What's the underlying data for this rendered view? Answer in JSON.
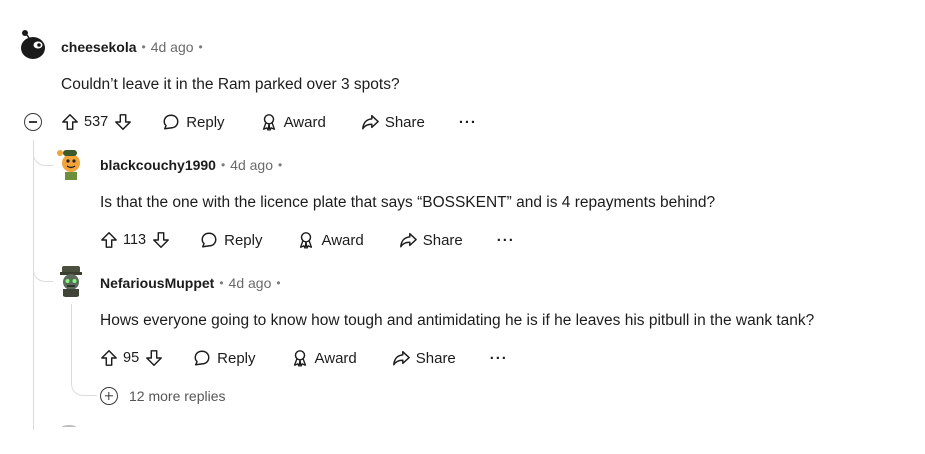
{
  "comments": [
    {
      "author": "cheesekola",
      "time": "4d ago",
      "separator": "•",
      "body": "Couldn’t leave it in the Ram parked over 3 spots?",
      "votes": "537",
      "reply_label": "Reply",
      "award_label": "Award",
      "share_label": "Share",
      "more_label": "···"
    },
    {
      "author": "blackcouchy1990",
      "time": "4d ago",
      "separator": "•",
      "body": "Is that the one with the licence plate that says “BOSSKENT” and is 4 repayments behind?",
      "votes": "113",
      "reply_label": "Reply",
      "award_label": "Award",
      "share_label": "Share",
      "more_label": "···"
    },
    {
      "author": "NefariousMuppet",
      "time": "4d ago",
      "separator": "•",
      "body": "Hows everyone going to know how tough and antimidating he is if he leaves his pitbull in the wank tank?",
      "votes": "95",
      "reply_label": "Reply",
      "award_label": "Award",
      "share_label": "Share",
      "more_label": "···"
    }
  ],
  "more_replies": "12 more replies",
  "icons": {
    "upvote": "arrow-up-outline-icon",
    "downvote": "arrow-down-outline-icon",
    "reply": "speech-bubble-icon",
    "award": "award-ribbon-icon",
    "share": "share-arrow-icon",
    "collapse": "minus-circle-icon",
    "expand": "plus-circle-icon"
  }
}
